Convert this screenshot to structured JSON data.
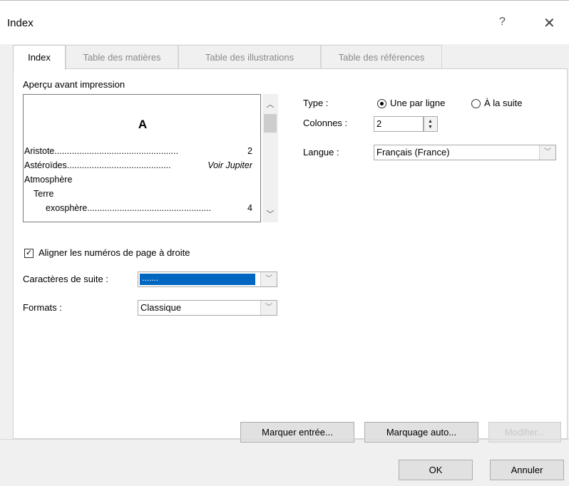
{
  "dialog": {
    "title": "Index",
    "help": "?",
    "close": "✕"
  },
  "tabs": [
    {
      "label": "Index",
      "active": true
    },
    {
      "label": "Table des matières",
      "active": false
    },
    {
      "label": "Table des illustrations",
      "active": false
    },
    {
      "label": "Table des références",
      "active": false
    }
  ],
  "preview": {
    "label": "Aperçu avant impression",
    "letter": "A",
    "lines": [
      {
        "text": "Aristote",
        "right": "2"
      },
      {
        "text": "Astéroïdes",
        "right": "Voir Jupiter"
      },
      {
        "text": "Atmosphère",
        "right": ""
      },
      {
        "text": "Terre",
        "right": ""
      },
      {
        "text": "exosphère",
        "right": "4"
      }
    ]
  },
  "type": {
    "label": "Type :",
    "options": [
      "Une par ligne",
      "À la suite"
    ],
    "selected": "Une par ligne"
  },
  "colonnes": {
    "label": "Colonnes :",
    "value": "2"
  },
  "langue": {
    "label": "Langue :",
    "value": "Français (France)"
  },
  "align": {
    "label": "Aligner les numéros de page à droite",
    "checked": true
  },
  "suite": {
    "label": "Caractères de suite :",
    "value": "......."
  },
  "formats": {
    "label": "Formats :",
    "value": "Classique"
  },
  "buttons": {
    "marquer_entree": "Marquer entrée...",
    "marquage_auto": "Marquage auto...",
    "modifier": "Modifier...",
    "ok": "OK",
    "annuler": "Annuler"
  },
  "icons": {
    "scroll_up": "chevron-up-icon",
    "scroll_down": "chevron-down-icon",
    "dropdown": "chevron-down-icon"
  }
}
